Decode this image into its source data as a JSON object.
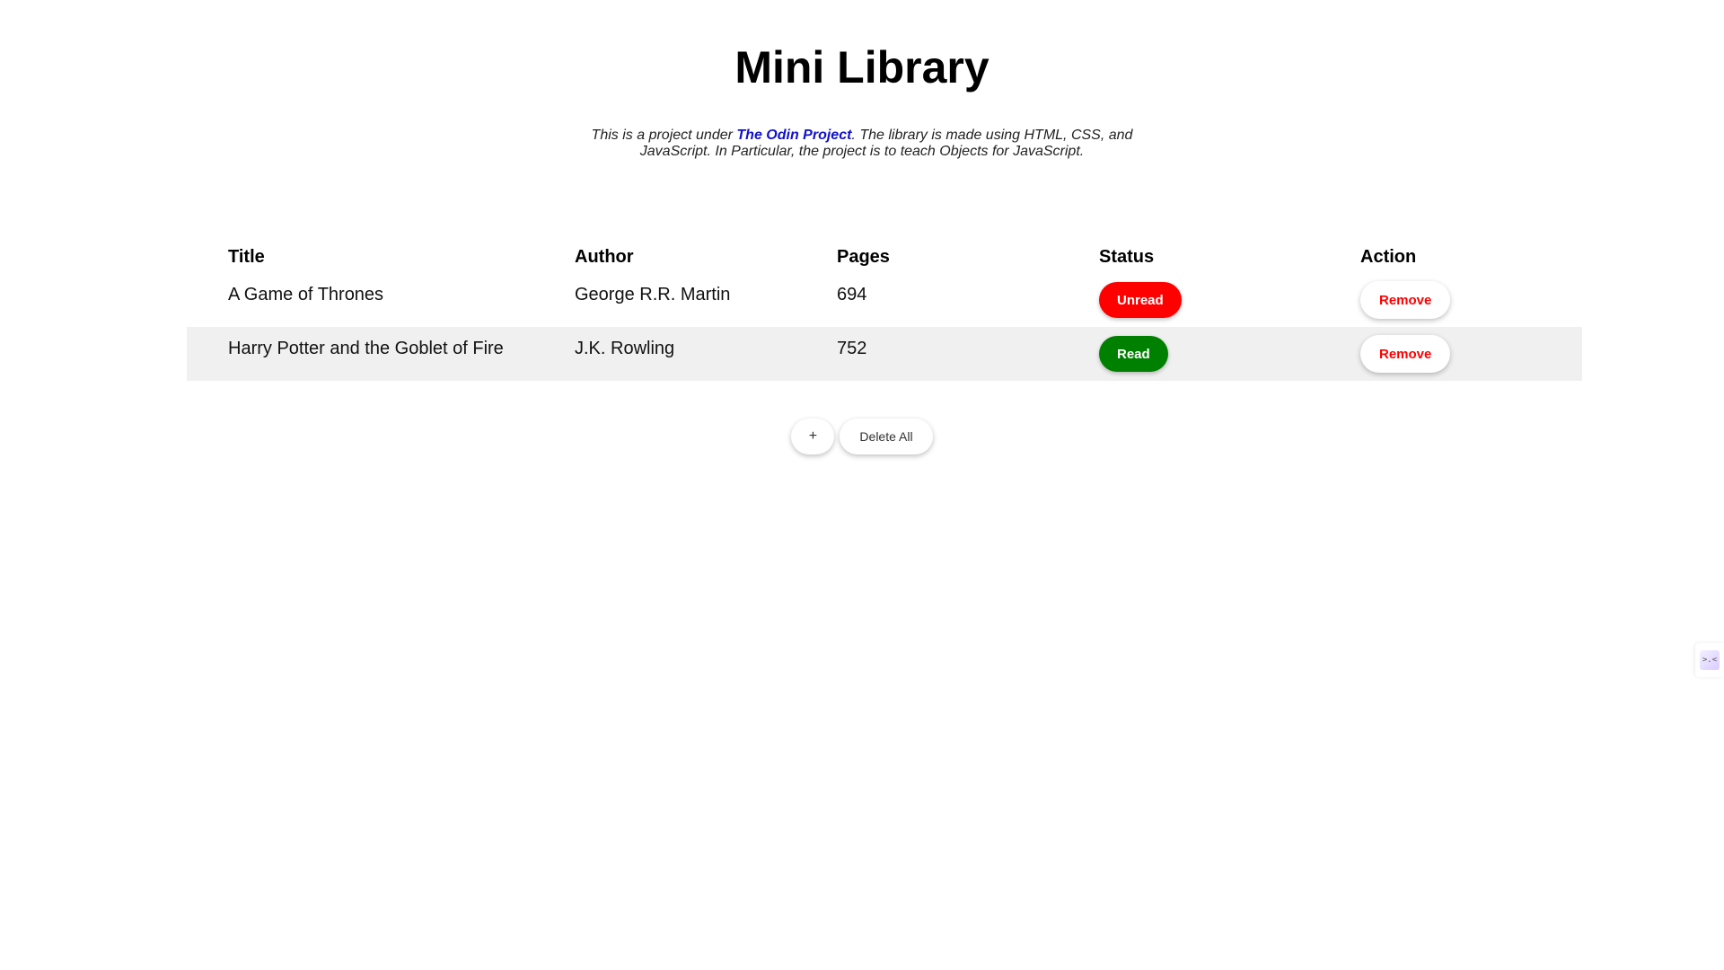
{
  "header": {
    "title": "Mini Library",
    "intro_before": "This is a project under ",
    "intro_link": "The Odin Project",
    "intro_after": ". The library is made using HTML, CSS, and JavaScript. In Particular, the project is to teach Objects for JavaScript."
  },
  "table": {
    "columns": [
      "Title",
      "Author",
      "Pages",
      "Status",
      "Action"
    ],
    "rows": [
      {
        "title": "A Game of Thrones",
        "author": "George R.R. Martin",
        "pages": "694",
        "status": "Unread",
        "action": "Remove"
      },
      {
        "title": "Harry Potter and the Goblet of Fire",
        "author": "J.K. Rowling",
        "pages": "752",
        "status": "Read",
        "action": "Remove"
      }
    ]
  },
  "controls": {
    "add_label": "+",
    "delete_all_label": "Delete All"
  },
  "side_widget": {
    "icon": "assistant-widget-icon",
    "glyph": ">.<"
  },
  "colors": {
    "unread": "#ff0000",
    "read": "#008000",
    "link": "#1111cc",
    "row_stripe": "#f0f0f0"
  }
}
